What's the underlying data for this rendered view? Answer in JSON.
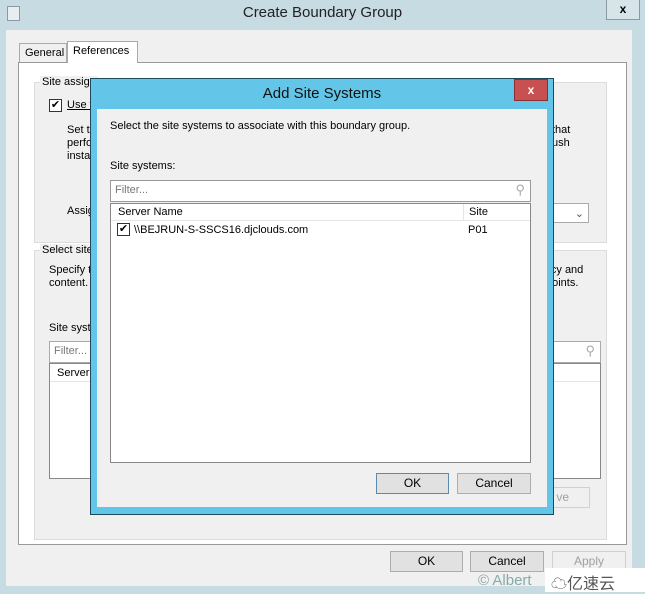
{
  "window": {
    "title": "Create Boundary Group",
    "close": "x"
  },
  "tabs": [
    {
      "label": "General"
    },
    {
      "label": "References"
    }
  ],
  "site_assignment": {
    "group_label": "Site assign",
    "checkbox_label": "Use t",
    "desc_left": [
      "Set th",
      "perfo",
      "instal"
    ],
    "desc_right": [
      "that",
      "ush"
    ],
    "assigned_label": "Assig"
  },
  "select_site": {
    "group_label": "Select site",
    "desc_left": [
      "Specify t",
      "content."
    ],
    "desc_right": [
      "licy and",
      "points."
    ],
    "list_label": "Site syste",
    "filter_placeholder": "Filter...",
    "column": "Server",
    "remove_label": "ve"
  },
  "footer": {
    "ok": "OK",
    "cancel": "Cancel",
    "apply": "Apply"
  },
  "watermark": {
    "credit": "© Albert",
    "logo": "亿速云"
  },
  "dialog": {
    "title": "Add Site Systems",
    "close": "x",
    "instruction": "Select the site systems to associate with this boundary group.",
    "list_label": "Site systems:",
    "filter_placeholder": "Filter...",
    "columns": [
      "Server Name",
      "Site"
    ],
    "rows": [
      {
        "checked": true,
        "server": "\\\\BEJRUN-S-SSCS16.djclouds.com",
        "site": "P01"
      }
    ],
    "ok": "OK",
    "cancel": "Cancel"
  },
  "colors": {
    "dialog_frame": "#63c6e8",
    "close_red": "#c75050"
  }
}
